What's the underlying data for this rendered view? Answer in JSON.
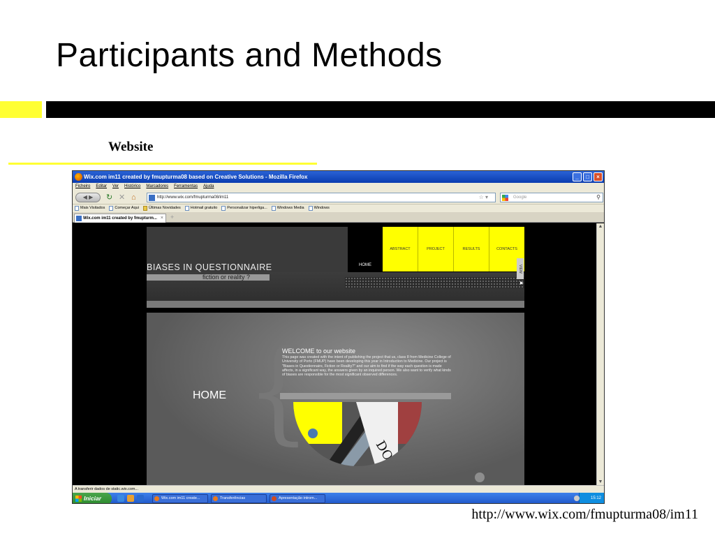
{
  "slide": {
    "title": "Participants and Methods",
    "subtitle": "Website",
    "url_caption": "http://www.wix.com/fmupturma08/im11"
  },
  "browser": {
    "window_title": "Wix.com im11 created by fmupturma08 based on Creative Solutions - Mozilla Firefox",
    "menu": [
      "Ficheiro",
      "Editar",
      "Ver",
      "Histórico",
      "Marcadores",
      "Ferramentas",
      "Ajuda"
    ],
    "address": "http://www.wix.com/fmupturma08/im11",
    "search_placeholder": "Google",
    "bookmarks": [
      "Mais Visitados",
      "Começar Aqui",
      "Últimas Novidades",
      "Hotmail gratuito",
      "Personalizar hiperliga...",
      "Windows Media",
      "Windows"
    ],
    "tab_label": "Wix.com im11 created by fmupturm...",
    "status_text": "A transferir dados de static.wix.com..."
  },
  "website": {
    "brand_title": "BIASES IN QUESTIONNAIRE",
    "brand_subtitle": "fiction or reality ?",
    "nav": [
      "ABSTRACT",
      "PROJECT",
      "RESULTS",
      "CONTACTS"
    ],
    "nav_home": "HOME",
    "side_tab": "VIEW",
    "panel_title": "HOME",
    "welcome_title": "WELCOME to our website",
    "welcome_text": "This page was created with the intent of publishing the project that us, class 8 from Medicine College of University of Porto (FMUP) have been developing this year in Introduction to Medicine. Our project is \"Biases in Questionnaire, Fiction or Reality?\" and our aim to find if the way each question is made affects, in a significant way, the answers given by an inquired person. We also want to verify what kinds of biases are responsible for the most significant observed differences."
  },
  "taskbar": {
    "start_label": "Iniciar",
    "tasks": [
      "Wix.com im11 create...",
      "Transferências",
      "Apresentação introm..."
    ],
    "clock": "15:12"
  },
  "colors": {
    "accent_yellow": "#ffff33",
    "xp_blue": "#2a63d6",
    "start_green": "#3a9a3c"
  }
}
